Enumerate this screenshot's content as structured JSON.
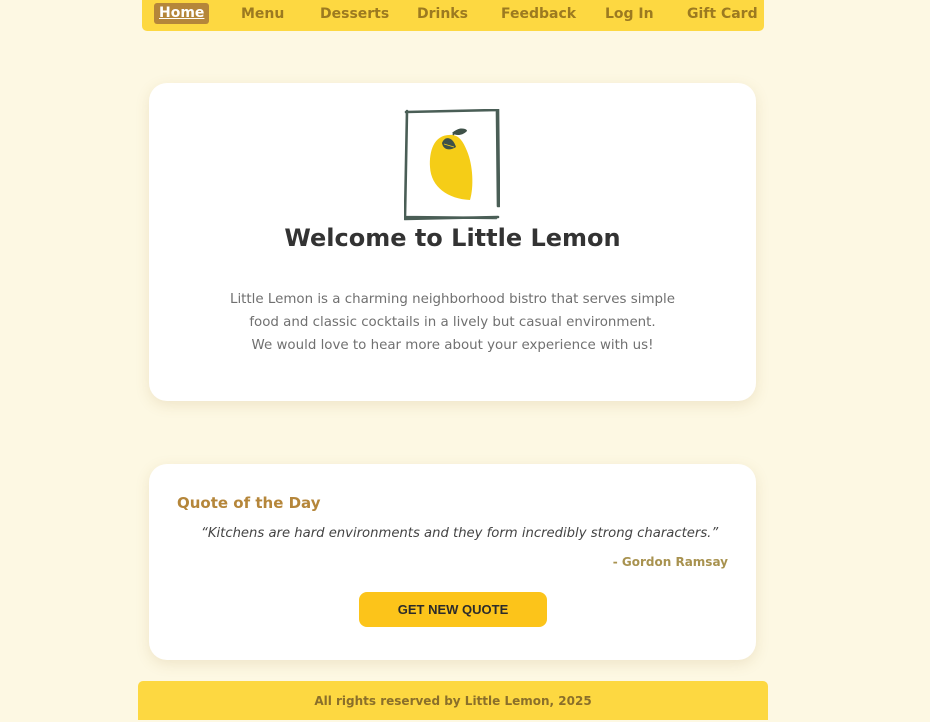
{
  "nav": {
    "items": [
      {
        "label": "Home",
        "active": true
      },
      {
        "label": "Menu"
      },
      {
        "label": "Desserts"
      },
      {
        "label": "Drinks"
      },
      {
        "label": "Feedback"
      },
      {
        "label": "Log In"
      },
      {
        "label": "Gift Card"
      }
    ]
  },
  "welcome": {
    "logo_icon": "lemon-logo-icon",
    "title": "Welcome to Little Lemon",
    "description_lines": [
      "Little Lemon is a charming neighborhood bistro that serves simple",
      "food and classic cocktails in a lively but casual environment.",
      "We would love to hear more about your experience with us!"
    ]
  },
  "quote": {
    "heading": "Quote of the Day",
    "text": "“Kitchens are hard environments and they form incredibly strong characters.”",
    "author": "- Gordon Ramsay",
    "button_label": "GET NEW QUOTE"
  },
  "footer": {
    "text": "All rights reserved by Little Lemon, 2025"
  },
  "colors": {
    "background": "#fdf8e3",
    "nav_background": "#fdd841",
    "accent": "#b5863a",
    "button": "#fcc41a",
    "lemon": "#f5cd17",
    "logo_frame": "#4a5e56"
  }
}
